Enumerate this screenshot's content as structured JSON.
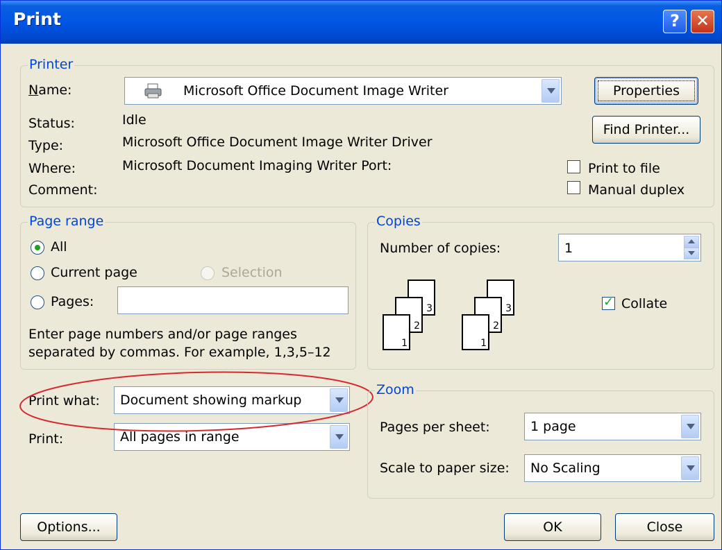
{
  "window": {
    "title": "Print",
    "help_icon": "question-icon",
    "close_icon": "close-x-icon"
  },
  "printer": {
    "legend": "Printer",
    "name_label": "Name:",
    "name_value": "Microsoft Office Document Image Writer",
    "status_label": "Status:",
    "status_value": "Idle",
    "type_label": "Type:",
    "type_value": "Microsoft Office Document Image Writer Driver",
    "where_label": "Where:",
    "where_value": "Microsoft Document Imaging Writer Port:",
    "comment_label": "Comment:",
    "properties": "Properties",
    "find_printer": "Find Printer...",
    "print_to_file": "Print to file",
    "manual_duplex": "Manual duplex"
  },
  "page_range": {
    "legend": "Page range",
    "all": "All",
    "current_page": "Current page",
    "selection": "Selection",
    "pages": "Pages:",
    "pages_value": "",
    "help_line1": "Enter page numbers and/or page ranges",
    "help_line2": "separated by commas.  For example, 1,3,5–12"
  },
  "copies": {
    "legend": "Copies",
    "number_label": "Number of copies:",
    "number_value": "1",
    "collate": "Collate",
    "collate_checked": true
  },
  "print_what": {
    "label": "Print what:",
    "value": "Document showing markup"
  },
  "print": {
    "label": "Print:",
    "value": "All pages in range"
  },
  "zoom": {
    "legend": "Zoom",
    "pages_per_sheet_label": "Pages per sheet:",
    "pages_per_sheet_value": "1 page",
    "scale_label": "Scale to paper size:",
    "scale_value": "No Scaling"
  },
  "buttons": {
    "options": "Options...",
    "ok": "OK",
    "close": "Close"
  }
}
